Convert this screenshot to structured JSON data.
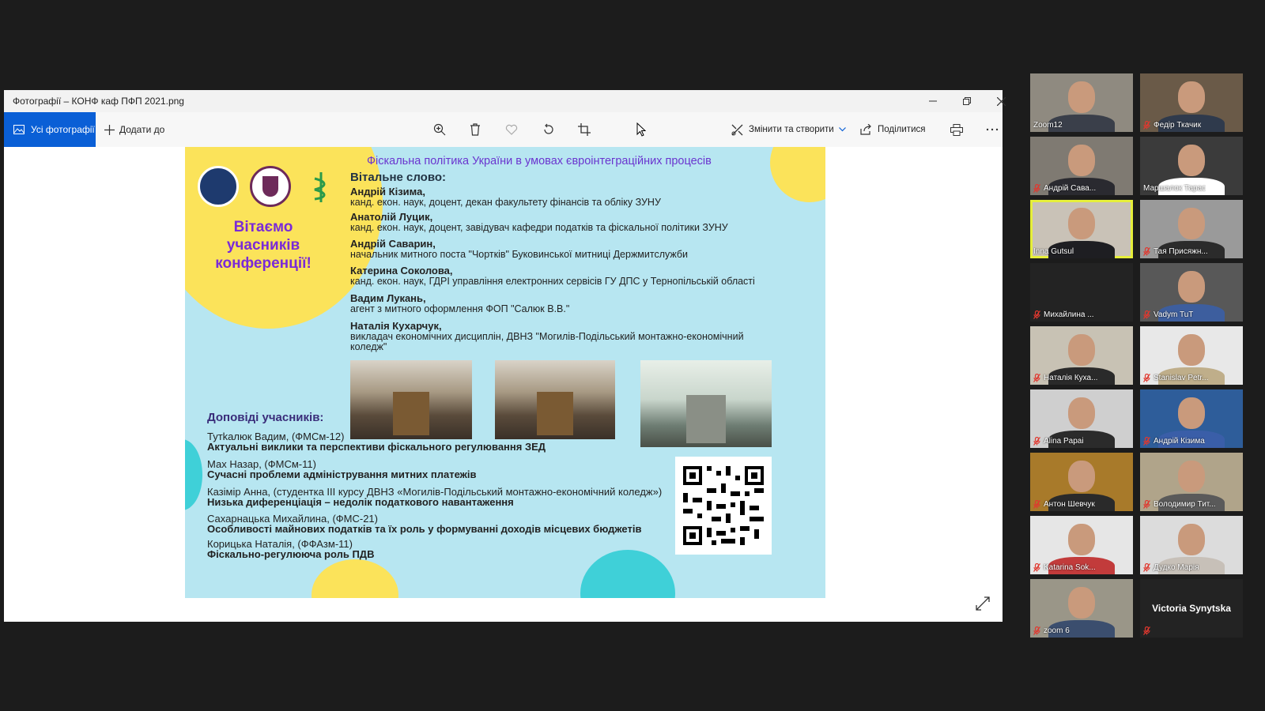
{
  "window": {
    "title": "Фотографії – КОНФ каф ПФП 2021.png",
    "all_photos_label": "Усі фотографії",
    "add_to_label": "Додати до",
    "edit_create_label": "Змінити та створити",
    "share_label": "Поділитися"
  },
  "poster": {
    "title": "Фіскальна політика України в умовах євроінтеграційних процесів",
    "welcome": "Вітаємо учасників конференції!",
    "greeting_heading": "Вітальне слово:",
    "speakers": [
      {
        "name": "Андрій Кізима,",
        "role": "канд. екон. наук, доцент, декан факультету фінансів та обліку ЗУНУ"
      },
      {
        "name": "Анатолій Луцик,",
        "role": "канд. екон. наук, доцент, завідувач кафедри податків та фіскальної політики ЗУНУ"
      },
      {
        "name": "Андрій Саварин,",
        "role": "начальник митного поста \"Чортків\" Буковинської митниці Держмитслужби"
      },
      {
        "name": "Катерина Соколова,",
        "role": "канд. екон. наук, ГДРІ управління електронних сервісів ГУ ДПС у Тернопільській області"
      },
      {
        "name": "Вадим Лукань,",
        "role": "агент з митного оформлення ФОП \"Салюк В.В.\""
      },
      {
        "name": "Наталія Кухарчук,",
        "role": "викладач економічних дисциплін, ДВНЗ \"Могилів-Подільський монтажно-економічний коледж\""
      }
    ],
    "reports_heading": "Доповіді учасників:",
    "reports": [
      {
        "author": "Тутkaлюк Вадим, (ФМСм-12)",
        "topic": "Актуальні виклики та перспективи фіскального регулювання ЗЕД"
      },
      {
        "author": "Мах Назар, (ФМСм-11)",
        "topic": "Сучасні проблеми адміністрування митних платежів"
      },
      {
        "author": "Казімір Анна, (студентка III курсу ДВНЗ «Могилів-Подільський монтажно-економічний коледж»)",
        "topic": "Низька диференціація – недолік податкового навантаження"
      },
      {
        "author": "Сахарнацька Михайлина, (ФМС-21)",
        "topic": "Особливості майнових податків та їх роль у формуванні доходів місцевих бюджетів"
      },
      {
        "author": "Корицька Наталія, (ФФАзм-11)",
        "topic": "Фіскально-регулююча роль ПДВ"
      }
    ]
  },
  "participants": [
    {
      "name": "Zoom12",
      "muted": false
    },
    {
      "name": "Федір Ткачик",
      "muted": true
    },
    {
      "name": "Андрій Сава...",
      "muted": true
    },
    {
      "name": "Маршалок Тарас",
      "muted": false
    },
    {
      "name": "Inna Gutsul",
      "muted": false,
      "active": true
    },
    {
      "name": "Тая Присяжн...",
      "muted": true
    },
    {
      "name": "Михайлина ...",
      "muted": true,
      "video": false
    },
    {
      "name": "Vadym TuT",
      "muted": true
    },
    {
      "name": "Наталія Куха...",
      "muted": true
    },
    {
      "name": "Stanislav Petr...",
      "muted": true
    },
    {
      "name": "Alina Papai",
      "muted": true
    },
    {
      "name": "Андрій Кізима",
      "muted": true
    },
    {
      "name": "Антон Шевчук",
      "muted": true
    },
    {
      "name": "Володимир Тит...",
      "muted": true
    },
    {
      "name": "Katarina Sok...",
      "muted": true
    },
    {
      "name": "Дудко Марія",
      "muted": true
    },
    {
      "name": "zoom 6",
      "muted": true
    },
    {
      "name": "",
      "muted": true,
      "video": false,
      "display_name": "Victoria Synytska"
    }
  ],
  "colors": {
    "accent": "#0a5fd6",
    "poster_bg": "#b7e6f1",
    "poster_yellow": "#fbe35a",
    "poster_purple": "#7a2ad8",
    "active_speaker": "#e6ef3a",
    "muted_icon": "#e0382f"
  },
  "icons": {
    "toolbar": [
      "zoom-in-icon",
      "delete-icon",
      "favorite-heart-icon",
      "rotate-icon",
      "crop-icon",
      "edit-create-icon",
      "share-icon",
      "print-icon",
      "more-icon"
    ],
    "window": [
      "minimize-icon",
      "restore-icon",
      "close-icon"
    ]
  }
}
